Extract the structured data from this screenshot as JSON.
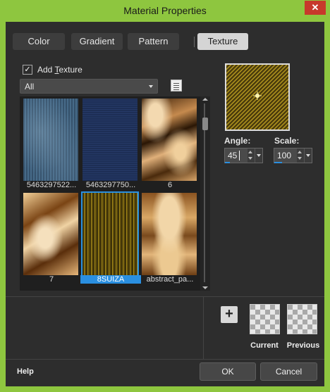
{
  "window": {
    "title": "Material Properties",
    "close_label": "✕"
  },
  "tabs": [
    {
      "label": "Color",
      "active": false
    },
    {
      "label": "Gradient",
      "active": false
    },
    {
      "label": "Pattern",
      "active": false
    },
    {
      "label": "Texture",
      "active": true
    }
  ],
  "add_texture": {
    "checked": true,
    "check_mark": "✓",
    "label_prefix": "Add ",
    "label_underlined": "T",
    "label_rest": "exture"
  },
  "category_dropdown": {
    "value": "All"
  },
  "browse_icon": "texture-library-icon",
  "thumbnails": [
    {
      "caption": "5463297522...",
      "texture": "blue-denim-light",
      "selected": false
    },
    {
      "caption": "5463297750...",
      "texture": "blue-denim-dark",
      "selected": false
    },
    {
      "caption": "6",
      "texture": "gold-swirl-tile",
      "selected": false
    },
    {
      "caption": "7",
      "texture": "gold-swirl",
      "selected": false
    },
    {
      "caption": "8SUIZA",
      "texture": "gold-stripes",
      "selected": true
    },
    {
      "caption": "abstract_pa...",
      "texture": "abstract-parchment",
      "selected": false
    }
  ],
  "angle": {
    "label": "Angle:",
    "value": "45",
    "fraction": 0.125
  },
  "scale": {
    "label": "Scale:",
    "value": "100",
    "fraction": 0.2
  },
  "swatches": {
    "add_label": "+",
    "current_label": "Current",
    "previous_label": "Previous"
  },
  "footer": {
    "help": "Help",
    "ok": "OK",
    "cancel": "Cancel"
  },
  "colors": {
    "accent": "#2a8fe0",
    "title_bar": "#8ec63f",
    "background": "#2d2d2d",
    "close": "#c7392b"
  }
}
